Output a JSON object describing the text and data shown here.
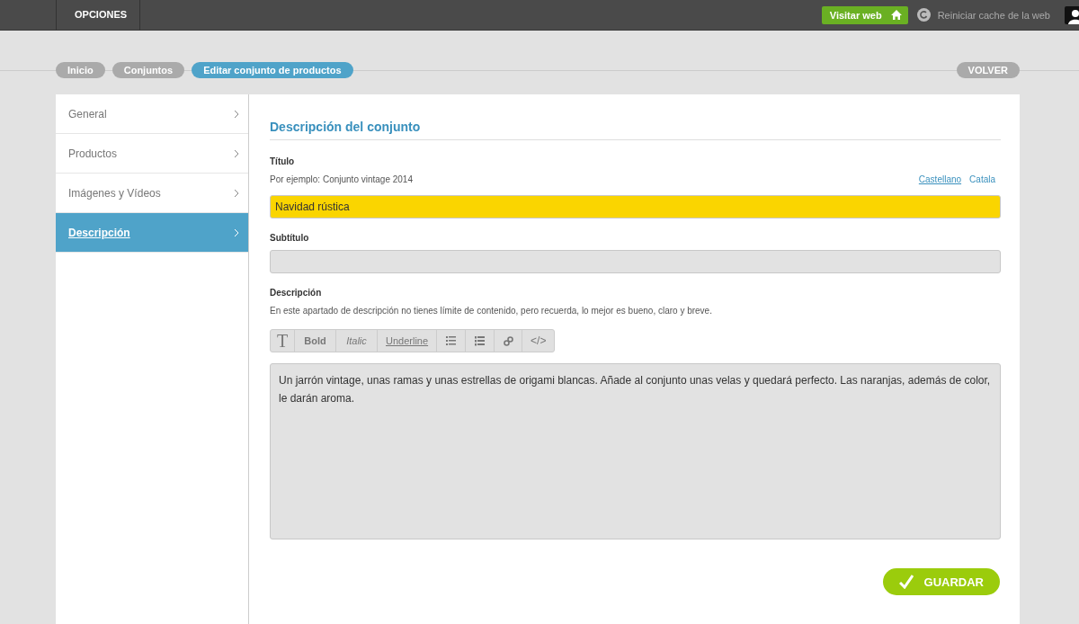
{
  "topbar": {
    "nav": [
      {
        "label": "OPCIONES",
        "selected": false
      }
    ],
    "visit_button": "Visitar web",
    "cache_link": "Reiniciar cache de la web"
  },
  "breadcrumbs": [
    {
      "label": "Inicio",
      "selected": false
    },
    {
      "label": "Conjuntos",
      "selected": false
    },
    {
      "label": "Editar conjunto de productos",
      "selected": true
    }
  ],
  "back_button": "VOLVER",
  "sidebar": {
    "items": [
      {
        "label": "General",
        "selected": false
      },
      {
        "label": "Productos",
        "selected": false
      },
      {
        "label": "Imágenes y Vídeos",
        "selected": false
      },
      {
        "label": "Descripción",
        "selected": true
      }
    ]
  },
  "form": {
    "heading": "Descripción del conjunto",
    "title_field": {
      "label": "Título",
      "hint": "Por ejemplo: Conjunto vintage 2014",
      "languages": [
        {
          "label": "Castellano",
          "selected": true
        },
        {
          "label": "Catala",
          "selected": false
        }
      ],
      "value": "Navidad rústica"
    },
    "subtitle_field": {
      "label": "Subtítulo"
    },
    "description_field": {
      "label": "Descripción",
      "hint": "En este apartado de descripción no tienes límite de contenido, pero recuerda, lo mejor es bueno, claro y breve.",
      "toolbar": [
        {
          "kind": "heading",
          "label": "T"
        },
        {
          "kind": "bold",
          "label": "Bold"
        },
        {
          "kind": "italic",
          "label": "Italic"
        },
        {
          "kind": "underline",
          "label": "Underline"
        },
        {
          "kind": "bullets"
        },
        {
          "kind": "numbers"
        },
        {
          "kind": "link"
        },
        {
          "kind": "code",
          "label": "</>"
        }
      ],
      "value": "Un jarrón vintage, unas ramas y unas estrellas de origami blancas. Añade al conjunto unas velas y quedará perfecto. Las naranjas, además de color, le darán aroma."
    },
    "save_button": "GUARDAR"
  }
}
